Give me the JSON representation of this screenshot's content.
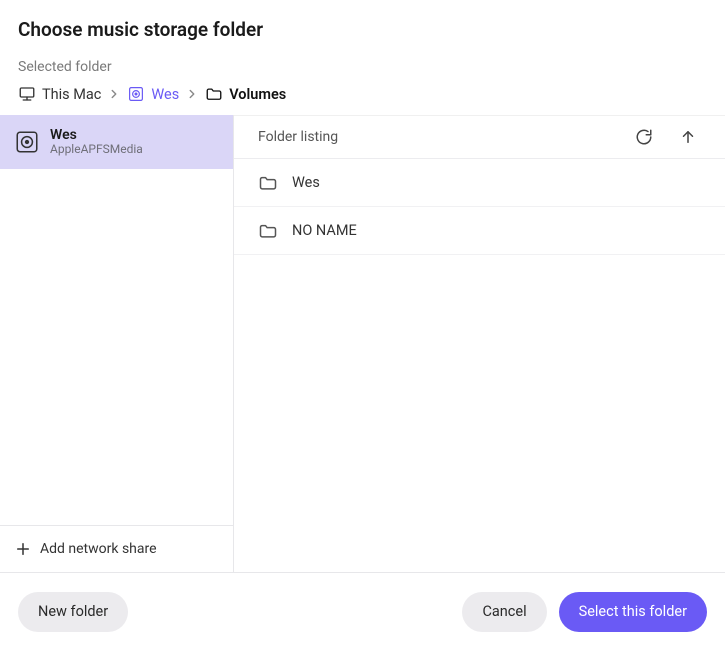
{
  "header": {
    "title": "Choose music storage folder",
    "selected_label": "Selected folder"
  },
  "breadcrumb": {
    "items": [
      {
        "label": "This Mac",
        "icon": "computer"
      },
      {
        "label": "Wes",
        "icon": "disk",
        "active": true
      },
      {
        "label": "Volumes",
        "icon": "folder",
        "current": true
      }
    ]
  },
  "sidebar": {
    "drive": {
      "name": "Wes",
      "subtitle": "AppleAPFSMedia"
    },
    "add_share_label": "Add network share"
  },
  "listing": {
    "header_label": "Folder listing",
    "rows": [
      {
        "name": "Wes"
      },
      {
        "name": "NO NAME"
      }
    ]
  },
  "footer": {
    "new_folder": "New folder",
    "cancel": "Cancel",
    "select": "Select this folder"
  }
}
